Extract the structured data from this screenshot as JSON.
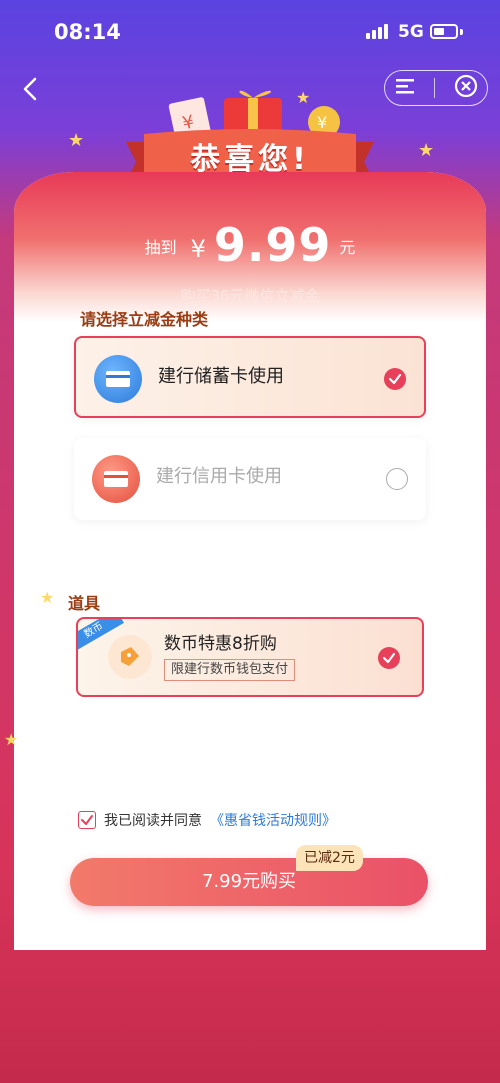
{
  "status_bar": {
    "time": "08:14",
    "network": "5G"
  },
  "banner": {
    "title": "恭喜您!"
  },
  "prize": {
    "prefix": "抽到",
    "currency": "¥",
    "amount": "9.99",
    "unit": "元",
    "subtitle": "购买36元微信立减金"
  },
  "sections": {
    "choose_type": "请选择立减金种类",
    "props": "道具"
  },
  "options": [
    {
      "label": "建行储蓄卡使用",
      "selected": true,
      "icon": "bank-card-icon",
      "color": "#3a8ee8"
    },
    {
      "label": "建行信用卡使用",
      "selected": false,
      "icon": "credit-card-icon",
      "color": "#ec6a56"
    }
  ],
  "coupon": {
    "tag": "数币",
    "title": "数币特惠8折购",
    "subtitle": "限建行数币钱包支付",
    "selected": true
  },
  "agreement": {
    "text": "我已阅读并同意",
    "link": "《惠省钱活动规则》",
    "checked": true
  },
  "buy": {
    "label": "7.99元购买",
    "badge": "已减2元"
  },
  "colors": {
    "accent": "#e8405a",
    "section_title": "#9a3d13",
    "link": "#2f7ad8"
  }
}
